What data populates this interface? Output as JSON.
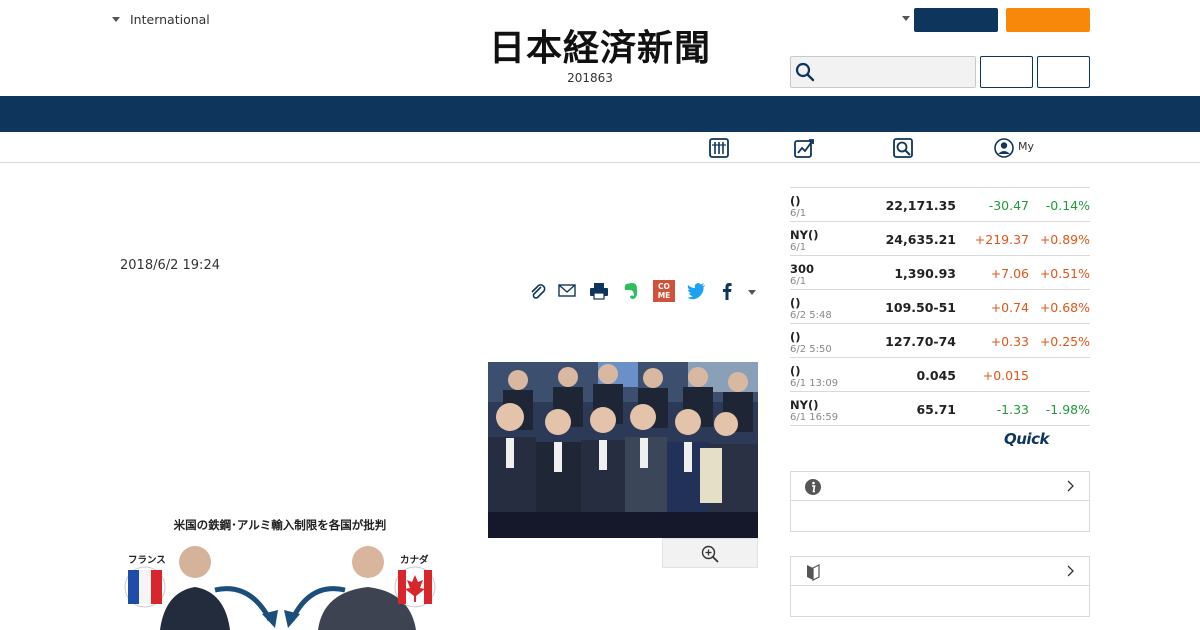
{
  "header": {
    "region_label": "International",
    "logo_text": "日本経済新聞",
    "edition_number": "201863",
    "nav_colors": {
      "navy": "#0e365c",
      "orange": "#f7880a"
    },
    "subnav": {
      "my_label": "My"
    }
  },
  "article": {
    "datetime": "2018/6/2 19:24",
    "share_icons": [
      "clip-icon",
      "mail-icon",
      "print-icon",
      "evernote-icon",
      "come-icon",
      "twitter-icon",
      "facebook-icon",
      "more-icon"
    ],
    "come_label": "CO ME",
    "infographic": {
      "title": "米国の鉄鋼･アルミ輸入制限を各国が批判",
      "left_country": "フランス",
      "right_country": "カナダ"
    }
  },
  "market": {
    "rows": [
      {
        "name": "()",
        "date": "6/1",
        "value": "22,171.35",
        "change": "-30.47",
        "pct": "-0.14%",
        "dir": "down"
      },
      {
        "name": "NY()",
        "date": "6/1",
        "value": "24,635.21",
        "change": "+219.37",
        "pct": "+0.89%",
        "dir": "up"
      },
      {
        "name": "300",
        "date": "6/1",
        "value": "1,390.93",
        "change": "+7.06",
        "pct": "+0.51%",
        "dir": "up"
      },
      {
        "name": "()",
        "date": "6/2 5:48",
        "value": "109.50-51",
        "change": "+0.74",
        "pct": "+0.68%",
        "dir": "up"
      },
      {
        "name": "()",
        "date": "6/2 5:50",
        "value": "127.70-74",
        "change": "+0.33",
        "pct": "+0.25%",
        "dir": "up"
      },
      {
        "name": "()",
        "date": "6/1 13:09",
        "value": "0.045",
        "change": "+0.015",
        "pct": "",
        "dir": "up"
      },
      {
        "name": "NY()",
        "date": "6/1 16:59",
        "value": "65.71",
        "change": "-1.33",
        "pct": "-1.98%",
        "dir": "down"
      }
    ],
    "provider": "Quick"
  },
  "panels": [
    {
      "icon": "info-icon"
    },
    {
      "icon": "beginner-mark-icon"
    }
  ]
}
